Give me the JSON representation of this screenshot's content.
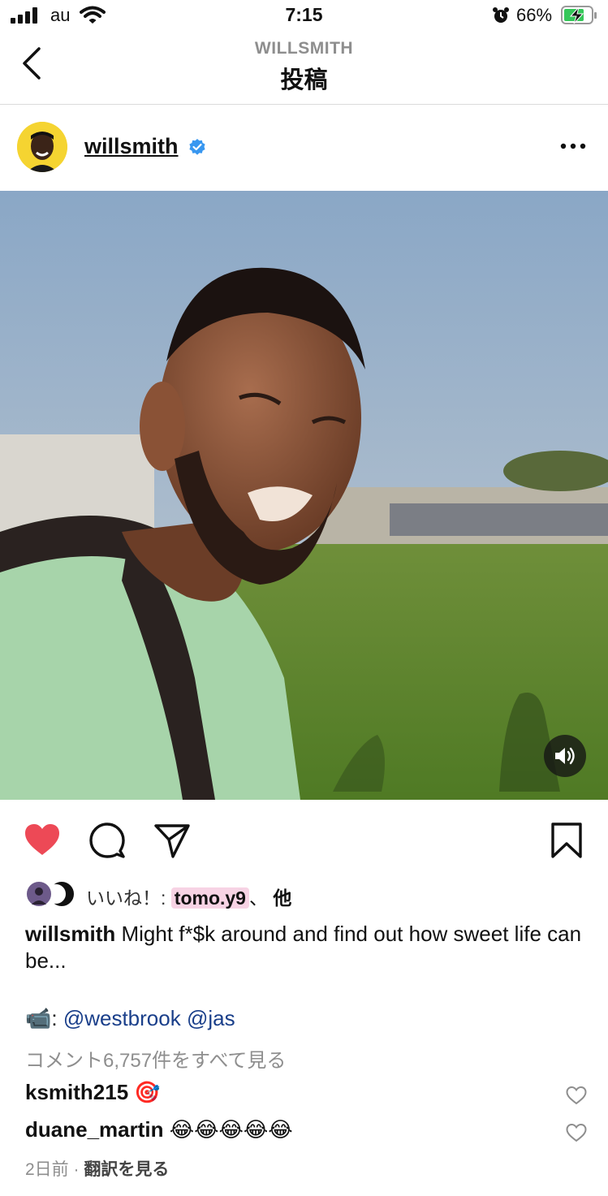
{
  "status_bar": {
    "carrier": "au",
    "time": "7:15",
    "battery": "66%"
  },
  "header": {
    "subtitle": "WILLSMITH",
    "title": "投稿"
  },
  "post": {
    "username": "willsmith",
    "likes": {
      "label": "いいね！: ",
      "user": "tomo.y9",
      "separator": "、",
      "suffix": "他"
    },
    "caption": {
      "username": "willsmith",
      "text": "Might f*$k around and find out how sweet life can be..."
    },
    "credit": {
      "emoji": "📹",
      "separator": ": ",
      "mention1": "@westbrook",
      "mention2": "@jas"
    },
    "view_all_comments": "コメント6,757件をすべて見る",
    "comments": [
      {
        "username": "ksmith215",
        "text": "🎯"
      },
      {
        "username": "duane_martin",
        "text": "😂😂😂😂😂"
      }
    ],
    "time_ago": "2日前",
    "meta_separator": " · ",
    "translate": "翻訳を見る"
  },
  "colors": {
    "like_red": "#ed4956",
    "verified_blue": "#3897f0",
    "mention_blue": "#1a3f8a",
    "avatar_bg": "#f5d431"
  },
  "icons": [
    "signal-icon",
    "wifi-icon",
    "alarm-icon",
    "battery-charging-icon",
    "back-chevron-icon",
    "verified-badge-icon",
    "more-icon",
    "volume-icon",
    "heart-filled-icon",
    "comment-icon",
    "share-icon",
    "bookmark-icon",
    "heart-outline-icon"
  ]
}
